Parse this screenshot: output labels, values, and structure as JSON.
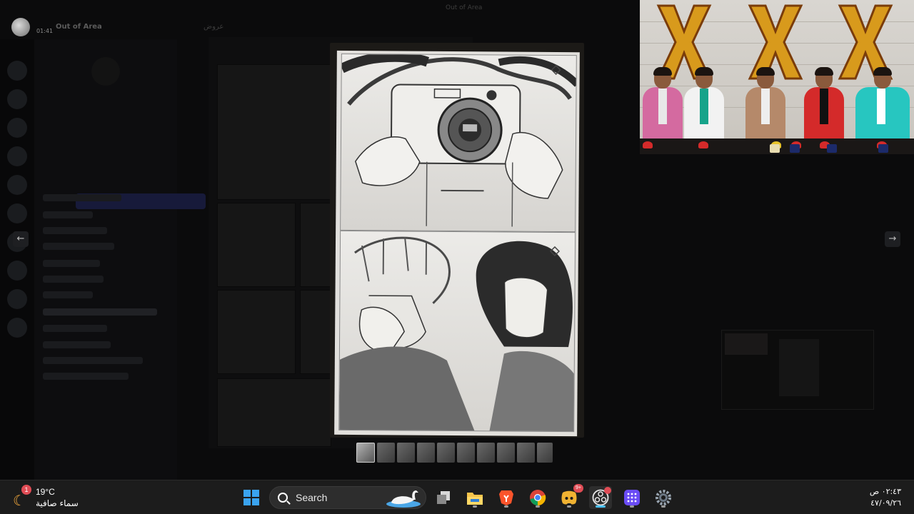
{
  "window": {
    "title": "Out of Area"
  },
  "discord": {
    "server_name": "Out of Area",
    "time_small": "01:41",
    "channel_name": "عروض"
  },
  "viewer": {
    "prev_arrow": "←",
    "next_arrow": "→",
    "thumbnail_count": 10
  },
  "taskbar": {
    "weather": {
      "badge": "1",
      "temp": "19°C",
      "condition": "سماء صافية"
    },
    "search": {
      "label": "Search"
    },
    "discord_badge": "9+",
    "clock": {
      "time": "٠٢:٤٣ ص",
      "date": "٤٧/٠٩/٢٦"
    }
  },
  "colors": {
    "taskbar_bg": "#1c1c1c",
    "accent": "#4cc2ff",
    "badge": "#e04c55"
  }
}
